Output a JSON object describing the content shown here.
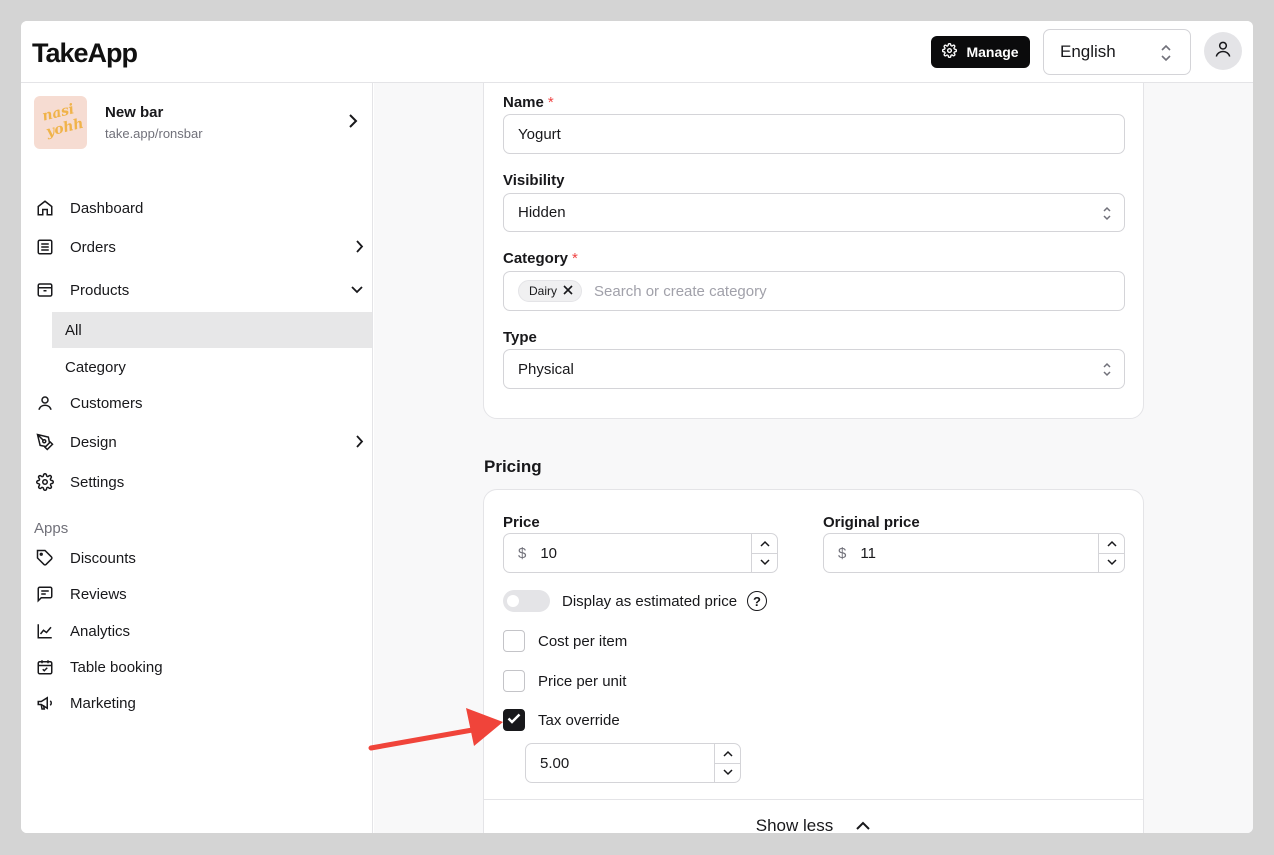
{
  "header": {
    "logo": "TakeApp",
    "manage_label": "Manage",
    "language": "English"
  },
  "store": {
    "thumb_text_1": "nasi",
    "thumb_text_2": "yohh",
    "name": "New bar",
    "url": "take.app/ronsbar"
  },
  "sidebar": {
    "items": [
      {
        "label": "Dashboard",
        "icon": "home-icon"
      },
      {
        "label": "Orders",
        "icon": "orders-icon"
      },
      {
        "label": "Products",
        "icon": "box-icon"
      },
      {
        "label": "Customers",
        "icon": "user-icon"
      },
      {
        "label": "Design",
        "icon": "pen-icon"
      },
      {
        "label": "Settings",
        "icon": "gear-icon"
      }
    ],
    "product_sub": [
      {
        "label": "All",
        "active": true
      },
      {
        "label": "Category",
        "active": false
      }
    ],
    "apps_label": "Apps",
    "apps": [
      {
        "label": "Discounts",
        "icon": "tag-icon"
      },
      {
        "label": "Reviews",
        "icon": "reviews-icon"
      },
      {
        "label": "Analytics",
        "icon": "chart-icon"
      },
      {
        "label": "Table booking",
        "icon": "calendar-icon"
      },
      {
        "label": "Marketing",
        "icon": "megaphone-icon"
      }
    ]
  },
  "form": {
    "name_label": "Name",
    "name_value": "Yogurt",
    "visibility_label": "Visibility",
    "visibility_value": "Hidden",
    "category_label": "Category",
    "category_chip": "Dairy",
    "category_placeholder": "Search or create category",
    "type_label": "Type",
    "type_value": "Physical",
    "required_mark": "*"
  },
  "pricing": {
    "section_title": "Pricing",
    "price_label": "Price",
    "price_value": "10",
    "original_price_label": "Original price",
    "original_price_value": "11",
    "currency": "$",
    "estimated_label": "Display as estimated price",
    "estimated_on": false,
    "cost_per_item_label": "Cost per item",
    "cost_per_item_checked": false,
    "price_per_unit_label": "Price per unit",
    "price_per_unit_checked": false,
    "tax_override_label": "Tax override",
    "tax_override_checked": true,
    "tax_value": "5.00",
    "show_less_label": "Show less"
  },
  "colors": {
    "accent_dark": "#0b0b0c",
    "required": "#ef4444",
    "annotation_arrow": "#f0443a"
  }
}
